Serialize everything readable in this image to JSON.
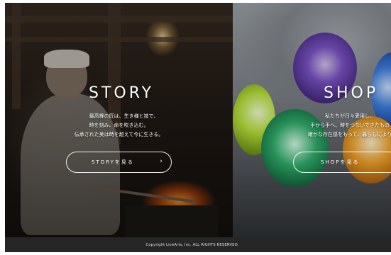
{
  "story": {
    "title": "STORY",
    "description": [
      "最高峰の匠は、生き様と技で、",
      "時を刻み、命を吹き込む。",
      "伝承された美は時を超えて今に生きる。"
    ],
    "button_label": "STORYを見る",
    "button_icon": "chevron-right-icon",
    "arrow": "›"
  },
  "shop": {
    "title": "SHOP",
    "description": [
      "私たちが日々愛用し、",
      "手から手へ、時をつないできたもの",
      "確かな存在感をもって、暮らしにより"
    ],
    "button_label": "SHOPを見る"
  },
  "footer": {
    "copyright": "Copyright LiveArts, Inc. ALL RIGHTS RESERVED."
  },
  "colors": {
    "footer_bg": "#262626",
    "text": "#ffffff"
  }
}
